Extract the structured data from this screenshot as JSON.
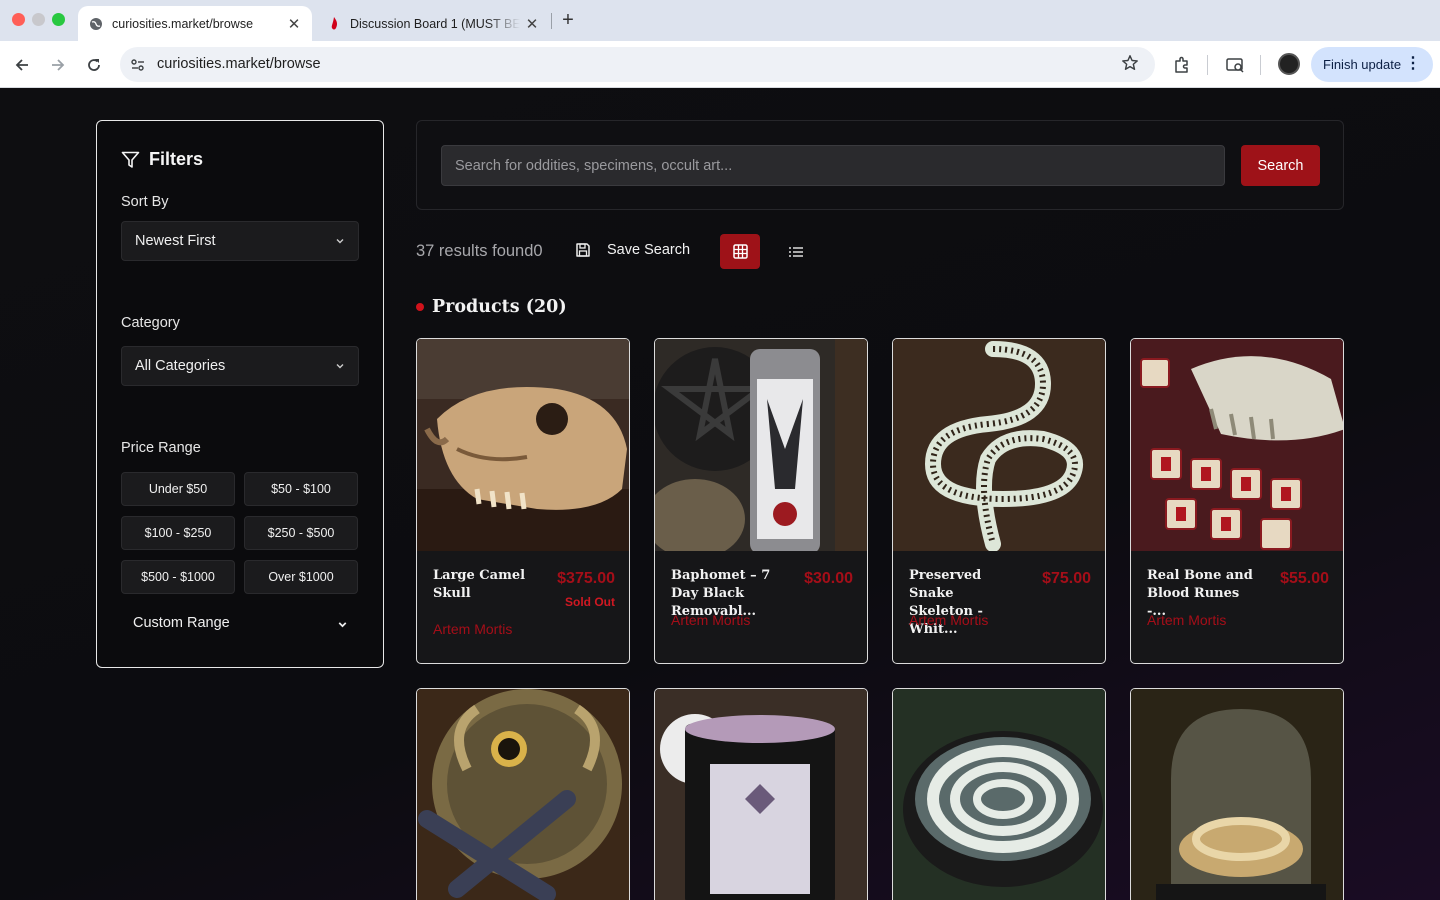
{
  "browser": {
    "tabs": [
      {
        "title": "curiosities.market/browse",
        "active": true
      },
      {
        "title": "Discussion Board 1 (MUST BE",
        "active": false
      }
    ],
    "url": "curiosities.market/browse",
    "finish_update_label": "Finish update"
  },
  "filters": {
    "title": "Filters",
    "sort_label": "Sort By",
    "sort_value": "Newest First",
    "category_label": "Category",
    "category_value": "All Categories",
    "price_label": "Price Range",
    "price_options": [
      "Under $50",
      "$50 - $100",
      "$100 - $250",
      "$250 - $500",
      "$500 - $1000",
      "Over $1000"
    ],
    "custom_range_label": "Custom Range"
  },
  "search": {
    "placeholder": "Search for oddities, specimens, occult art...",
    "button_label": "Search"
  },
  "results": {
    "count_text": "37 results found0",
    "save_search_label": "Save Search",
    "view_mode": "grid"
  },
  "section": {
    "heading": "Products (20)"
  },
  "products": [
    {
      "name": "Large Camel Skull",
      "price": "$375.00",
      "status": "Sold Out",
      "seller": "Artem Mortis"
    },
    {
      "name": "Baphomet – 7 Day Black Removabl...",
      "price": "$30.00",
      "status": "",
      "seller": "Artem Mortis"
    },
    {
      "name": "Preserved Snake Skeleton - Whit...",
      "price": "$75.00",
      "status": "",
      "seller": "Artem Mortis"
    },
    {
      "name": "Real Bone and Blood Runes -...",
      "price": "$55.00",
      "status": "",
      "seller": "Artem Mortis"
    }
  ],
  "colors": {
    "accent": "#9e1218",
    "price": "#a50e18",
    "background": "#0d0d0f"
  }
}
